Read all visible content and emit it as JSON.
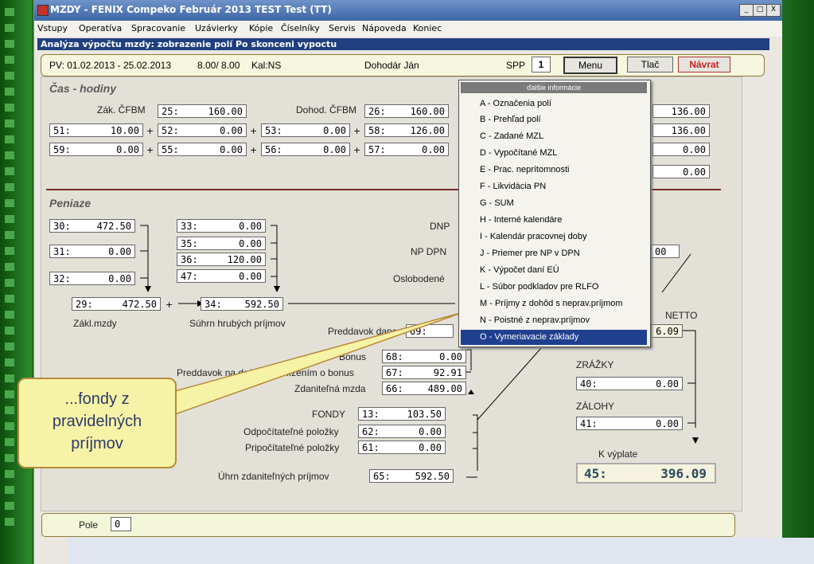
{
  "window": {
    "title": "MZDY - FENIX Compeko  Február 2013  TEST Test  (TT)",
    "controls": [
      "_",
      "□",
      "X"
    ]
  },
  "menubar": [
    "Vstupy",
    "Operatíva",
    "Spracovanie",
    "Uzávierky",
    "Kópie",
    "Číselníky",
    "Servis",
    "Nápoveda",
    "Koniec"
  ],
  "subtitle": "Analýza výpočtu mzdy: zobrazenie polí Po skonceni vypoctu",
  "topbar": {
    "period": "PV: 01.02.2013 - 25.02.2013",
    "hours": "8.00/ 8.00",
    "calendar": "Kal:NS",
    "employee": "Dohodár Ján",
    "spp_label": "SPP",
    "spp_value": "1",
    "menu_btn": "Menu",
    "print_btn": "Tlač",
    "back_btn": "Návrat"
  },
  "cas": {
    "title": "Čas - hodiny",
    "zak_label": "Zák. ČFBM",
    "zak": {
      "code": "25:",
      "val": "160.00"
    },
    "dohod_label": "Dohod. ČFBM",
    "dohod": {
      "code": "26:",
      "val": "160.00"
    },
    "row1": [
      {
        "code": "51:",
        "val": "10.00"
      },
      {
        "code": "52:",
        "val": "0.00"
      },
      {
        "code": "53:",
        "val": "0.00"
      },
      {
        "code": "58:",
        "val": "126.00"
      }
    ],
    "row2": [
      {
        "code": "59:",
        "val": "0.00"
      },
      {
        "code": "55:",
        "val": "0.00"
      },
      {
        "code": "56:",
        "val": "0.00"
      },
      {
        "code": "57:",
        "val": "0.00"
      }
    ],
    "right": [
      "136.00",
      "136.00",
      "0.00",
      "0.00"
    ]
  },
  "peniaze": {
    "title": "Peniaze",
    "left": [
      {
        "code": "30:",
        "val": "472.50"
      },
      {
        "code": "31:",
        "val": "0.00"
      },
      {
        "code": "32:",
        "val": "0.00"
      }
    ],
    "mid": [
      {
        "code": "33:",
        "val": "0.00"
      },
      {
        "code": "35:",
        "val": "0.00"
      },
      {
        "code": "36:",
        "val": "120.00"
      },
      {
        "code": "47:",
        "val": "0.00"
      }
    ],
    "f29": {
      "code": "29:",
      "val": "472.50"
    },
    "f34": {
      "code": "34:",
      "val": "592.50"
    },
    "zakl_label": "Zákl.mzdy",
    "suhrn_label": "Súhrn hrubých príjmov",
    "dnp_label": "DNP",
    "npdpn_label": "NP DPN",
    "oslob_label": "Oslobodené",
    "npdpn_partial": "00",
    "preddavok_label": "Preddavok dane",
    "preddavok_code": "69:",
    "netto_label": "NETTO",
    "netto_partial": "6.09",
    "bonus_label": "Bonus",
    "bonus": {
      "code": "68:",
      "val": "0.00"
    },
    "prededbon_label": "Preddavok na daň pred znížením o bonus",
    "prededbon": {
      "code": "67:",
      "val": "92.91"
    },
    "zdanit_label": "Zdaniteľná mzda",
    "zdanit": {
      "code": "66:",
      "val": "489.00"
    },
    "fondy_label": "FONDY",
    "fondy": {
      "code": "13:",
      "val": "103.50"
    },
    "odpoc_label": "Odpočítateľné položky",
    "odpoc": {
      "code": "62:",
      "val": "0.00"
    },
    "pripoc_label": "Pripočítateľné položky",
    "pripoc": {
      "code": "61:",
      "val": "0.00"
    },
    "uhrn_label": "Úhrn zdaniteľných príjmov",
    "uhrn": {
      "code": "65:",
      "val": "592.50"
    },
    "zrazky_label": "ZRÁŽKY",
    "zrazky": {
      "code": "40:",
      "val": "0.00"
    },
    "zalohy_label": "ZÁLOHY",
    "zalohy": {
      "code": "41:",
      "val": "0.00"
    },
    "kvyplate_label": "K výplate",
    "kvyplate": {
      "code": "45:",
      "val": "396.09"
    }
  },
  "ctxmenu": {
    "header": "ďalšie informácie",
    "items": [
      "A - Označenia polí",
      "B - Prehľad polí",
      "C - Zadané MZL",
      "D - Vypočítané MZL",
      "E - Prac. neprítomnosti",
      "F - Likvidácia PN",
      "G - SUM",
      "H - Interné kalendáre",
      "I - Kalendár pracovnej doby",
      "J - Priemer pre NP v DPN",
      "K - Výpočet daní EÚ",
      "L - Súbor podkladov pre RLFO",
      "M - Príjmy z dohôd s neprav.príjmom",
      "N - Poistné z neprav.príjmov",
      "O - Vymeriavacie základy"
    ],
    "selected_index": 14
  },
  "callout": {
    "line1": "...fondy z",
    "line2": "pravidelných",
    "line3": "príjmov"
  },
  "bottom": {
    "pole_label": "Pole",
    "pole_value": "0"
  }
}
